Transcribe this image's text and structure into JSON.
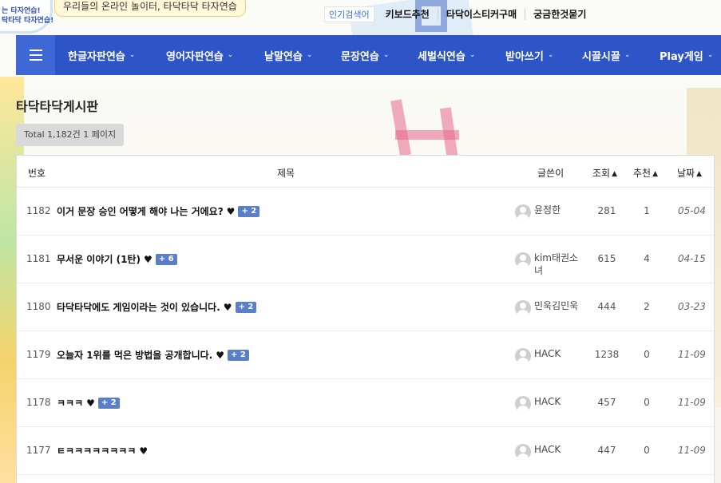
{
  "logo": {
    "line1": "는 타자연습!",
    "line2": "탁타닥 타자연습!"
  },
  "tagline": "우리들의 온라인 놀이터, 타닥타닥 타자연습",
  "top_links": {
    "hot_keyword": "인기검색어",
    "items": [
      "키보드추천",
      "타닥이스티커구매",
      "궁금한것묻기"
    ]
  },
  "nav": {
    "items": [
      "한글자판연습",
      "영어자판연습",
      "낱말연습",
      "문장연습",
      "세벌식연습",
      "받아쓰기",
      "시끌시끌",
      "Play게임"
    ]
  },
  "board": {
    "title": "타닥타닥게시판",
    "total": "Total 1,182건 1 페이지",
    "columns": {
      "num": "번호",
      "subject": "제목",
      "author": "글쓴이",
      "views": "조회",
      "recommend": "추천",
      "date": "날짜"
    },
    "rows": [
      {
        "num": "1182",
        "subject": "이거 문장 승인 어떻게 해야 나는 거에요?",
        "comments": "+ 2",
        "author": "윤정한",
        "views": "281",
        "recommend": "1",
        "date": "05-04"
      },
      {
        "num": "1181",
        "subject": "무서운 이야기 (1탄)",
        "comments": "+ 6",
        "author": "kim태권소녀",
        "views": "615",
        "recommend": "4",
        "date": "04-15"
      },
      {
        "num": "1180",
        "subject": "타닥타닥에도 게임이라는 것이 있습니다.",
        "comments": "+ 2",
        "author": "민욱김민욱",
        "views": "444",
        "recommend": "2",
        "date": "03-23"
      },
      {
        "num": "1179",
        "subject": "오늘자 1위를 먹은 방법을 공개합니다.",
        "comments": "+ 2",
        "author": "HACK",
        "views": "1238",
        "recommend": "0",
        "date": "11-09"
      },
      {
        "num": "1178",
        "subject": "ㅋㅋㅋ",
        "comments": "+ 2",
        "author": "HACK",
        "views": "457",
        "recommend": "0",
        "date": "11-09"
      },
      {
        "num": "1177",
        "subject": "ㅌㅋㅋㅋㅋㅋㅋㅋㅋ",
        "comments": "",
        "author": "HACK",
        "views": "447",
        "recommend": "0",
        "date": "11-09"
      }
    ]
  },
  "icons": {
    "heart": "heart-icon",
    "sort": "sort-icon",
    "chevron": "chevron-down-icon",
    "menu": "hamburger-menu-icon",
    "avatar": "user-avatar-icon"
  },
  "colors": {
    "nav_bg": "#2d55c8",
    "comment_badge": "#5b7fc7"
  }
}
